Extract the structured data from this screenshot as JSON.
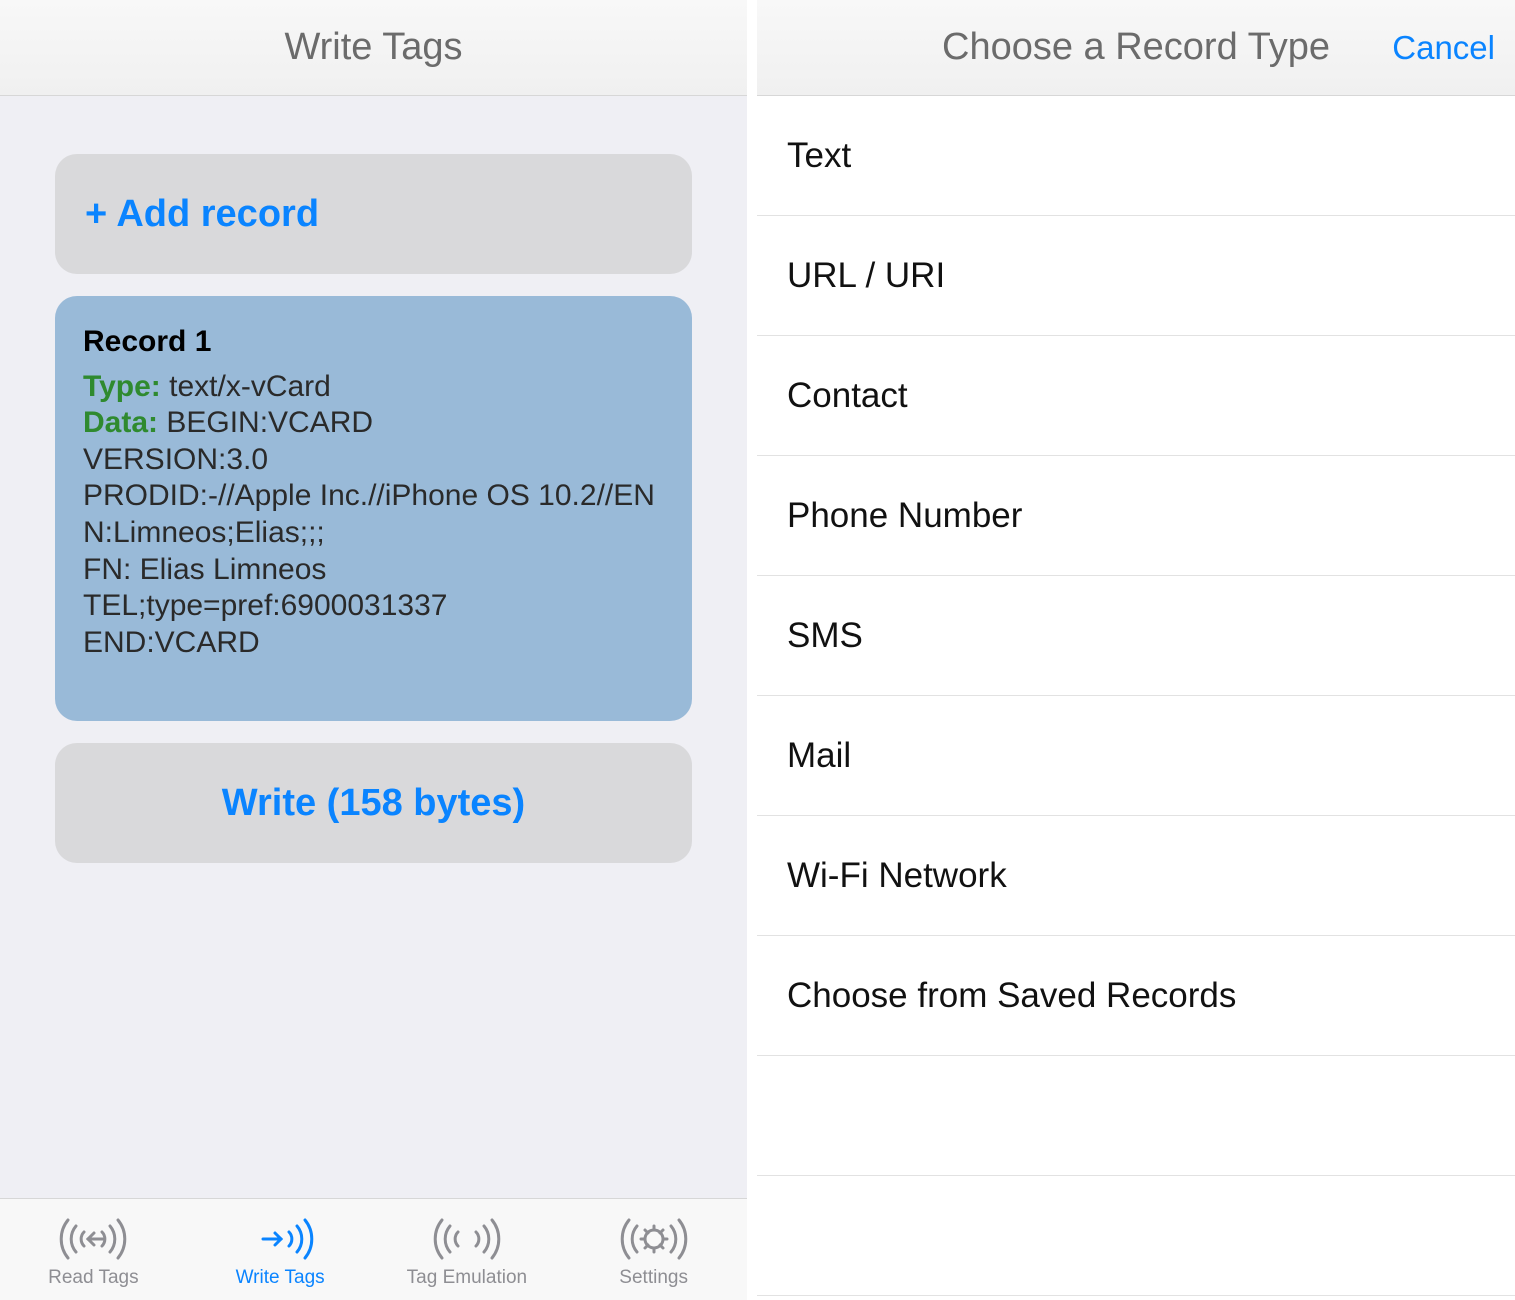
{
  "left": {
    "title": "Write Tags",
    "add_record_label": "+ Add record",
    "record": {
      "title": "Record 1",
      "type_label": "Type:",
      "type_value": "text/x-vCard",
      "data_label": "Data:",
      "data_first": "BEGIN:VCARD",
      "data_lines": [
        "VERSION:3.0",
        "PRODID:-//Apple Inc.//iPhone OS 10.2//EN",
        "N:Limneos;Elias;;;",
        "FN: Elias  Limneos",
        "TEL;type=pref:6900031337",
        "END:VCARD"
      ]
    },
    "write_label": "Write (158 bytes)",
    "tabs": [
      {
        "label": "Read Tags"
      },
      {
        "label": "Write Tags"
      },
      {
        "label": "Tag Emulation"
      },
      {
        "label": "Settings"
      }
    ]
  },
  "right": {
    "title": "Choose a Record Type",
    "cancel": "Cancel",
    "items": [
      {
        "label": "Text"
      },
      {
        "label": "URL / URI"
      },
      {
        "label": "Contact"
      },
      {
        "label": "Phone Number"
      },
      {
        "label": "SMS"
      },
      {
        "label": "Mail"
      },
      {
        "label": "Wi-Fi Network"
      },
      {
        "label": "Choose from Saved Records"
      }
    ]
  }
}
